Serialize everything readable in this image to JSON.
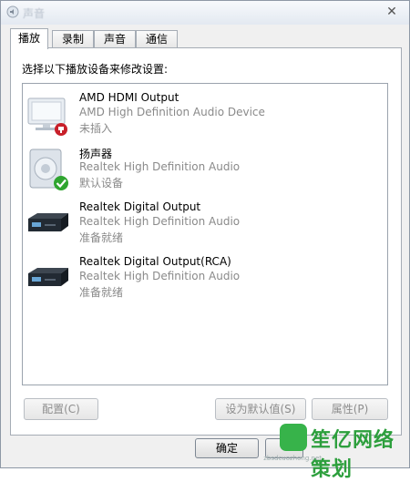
{
  "window": {
    "title": "声音",
    "close_glyph": "✕"
  },
  "tabs": [
    {
      "label": "播放",
      "active": true
    },
    {
      "label": "录制",
      "active": false
    },
    {
      "label": "声音",
      "active": false
    },
    {
      "label": "通信",
      "active": false
    }
  ],
  "panel": {
    "instruction": "选择以下播放设备来修改设置:",
    "devices": [
      {
        "name": "AMD HDMI Output",
        "driver": "AMD High Definition Audio Device",
        "status": "未插入",
        "icon": "monitor-icon",
        "badge": "not-plugged-badge"
      },
      {
        "name": "扬声器",
        "driver": "Realtek High Definition Audio",
        "status": "默认设备",
        "icon": "speaker-icon",
        "badge": "default-check-badge"
      },
      {
        "name": "Realtek Digital Output",
        "driver": "Realtek High Definition Audio",
        "status": "准备就绪",
        "icon": "digital-output-icon",
        "badge": ""
      },
      {
        "name": "Realtek Digital Output(RCA)",
        "driver": "Realtek High Definition Audio",
        "status": "准备就绪",
        "icon": "digital-output-icon",
        "badge": ""
      }
    ]
  },
  "buttons": {
    "configure": "配置(C)",
    "set_default": "设为默认值(S)",
    "properties": "属性(P)",
    "ok": "确定"
  },
  "watermark": {
    "brand": "笙亿网络策划",
    "small": "zbsdcuozhong.net"
  },
  "colors": {
    "default_badge": "#2fa52f",
    "not_plugged_badge": "#c8202a",
    "watermark_green": "#37b34a"
  }
}
